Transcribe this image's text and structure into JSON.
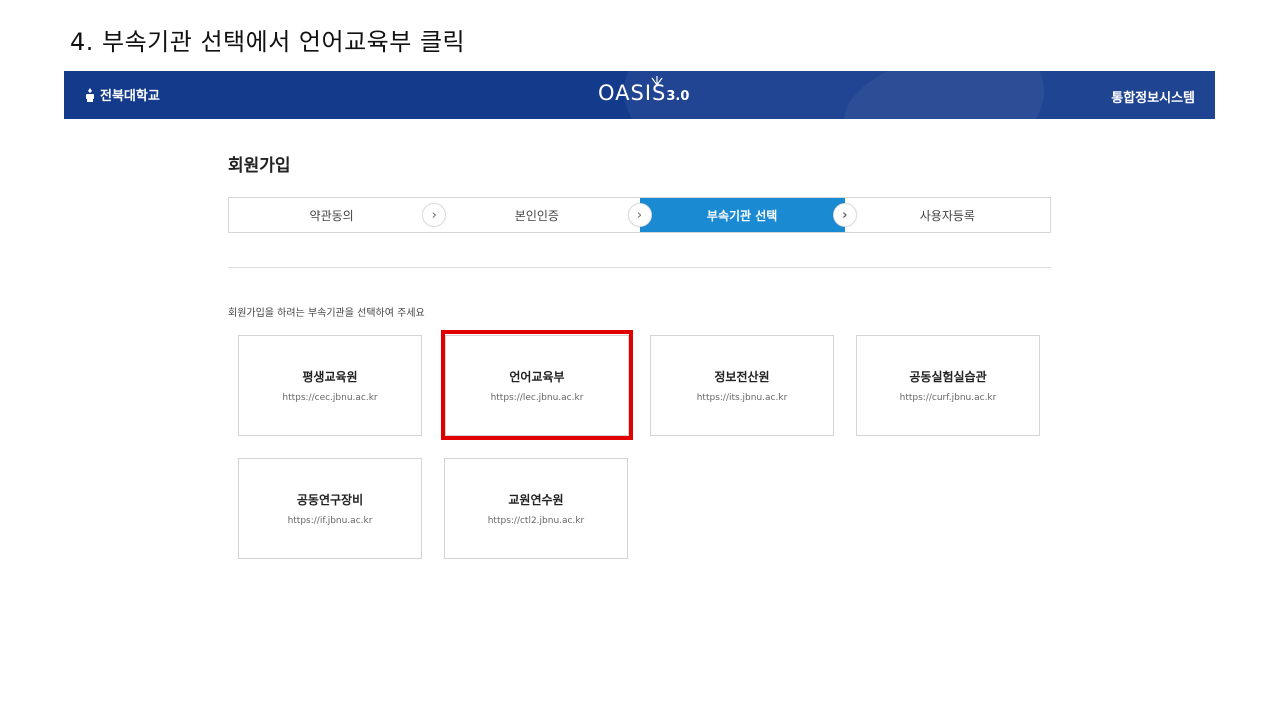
{
  "slide_title": "4. 부속기관 선택에서 언어교육부 클릭",
  "header": {
    "university": "전북대학교",
    "logo_main": "OASIS",
    "logo_version": "3.0",
    "system_name": "통합정보시스템",
    "background_color": "#143a8c"
  },
  "page_heading": "회원가입",
  "steps": [
    {
      "label": "약관동의",
      "active": false
    },
    {
      "label": "본인인증",
      "active": false
    },
    {
      "label": "부속기관 선택",
      "active": true
    },
    {
      "label": "사용자등록",
      "active": false
    }
  ],
  "step_arrow_icon": "chevron-right-icon",
  "active_step_color": "#1a8ad3",
  "instruction": "회원가입을 하려는 부속기관을 선택하여 주세요",
  "institutions": [
    {
      "name": "평생교육원",
      "url": "https://cec.jbnu.ac.kr"
    },
    {
      "name": "언어교육부",
      "url": "https://lec.jbnu.ac.kr"
    },
    {
      "name": "정보전산원",
      "url": "https://its.jbnu.ac.kr"
    },
    {
      "name": "공동실험실습관",
      "url": "https://curf.jbnu.ac.kr"
    },
    {
      "name": "공동연구장비",
      "url": "https://if.jbnu.ac.kr"
    },
    {
      "name": "교원연수원",
      "url": "https://ctl2.jbnu.ac.kr"
    }
  ],
  "highlight_color": "#e00000"
}
